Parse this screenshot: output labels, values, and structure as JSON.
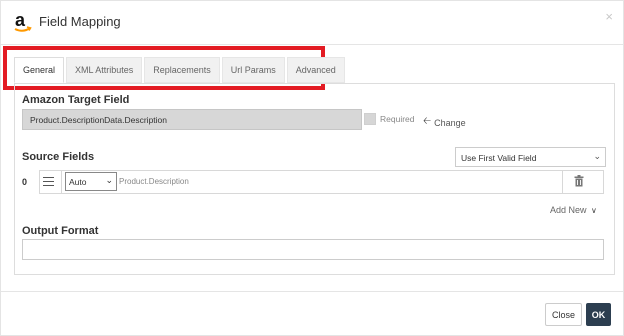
{
  "dialog": {
    "title": "Field Mapping",
    "close_glyph": "×",
    "logo_icon": "amazon-logo-icon"
  },
  "tabs": [
    {
      "label": "General",
      "active": true
    },
    {
      "label": "XML Attributes",
      "active": false
    },
    {
      "label": "Replacements",
      "active": false
    },
    {
      "label": "Url Params",
      "active": false
    },
    {
      "label": "Advanced",
      "active": false
    }
  ],
  "target": {
    "label": "Amazon Target Field",
    "value": "Product.DescriptionData.Description",
    "required_label": "Required",
    "required_checked": false,
    "change_label": "Change",
    "change_icon": "arrow-left-icon"
  },
  "source": {
    "label": "Source Fields",
    "mode_selected": "Use First Valid Field",
    "rows": [
      {
        "index": "0",
        "type_selected": "Auto",
        "value": "Product.Description"
      }
    ],
    "add_new_label": "Add New"
  },
  "output": {
    "label": "Output Format",
    "value": ""
  },
  "footer": {
    "close_label": "Close",
    "ok_label": "OK"
  },
  "colors": {
    "highlight_red": "#e31b23",
    "ok_button": "#2c3e50",
    "target_field_bg": "#d7d7d7",
    "amazon_orange": "#ff9900"
  }
}
